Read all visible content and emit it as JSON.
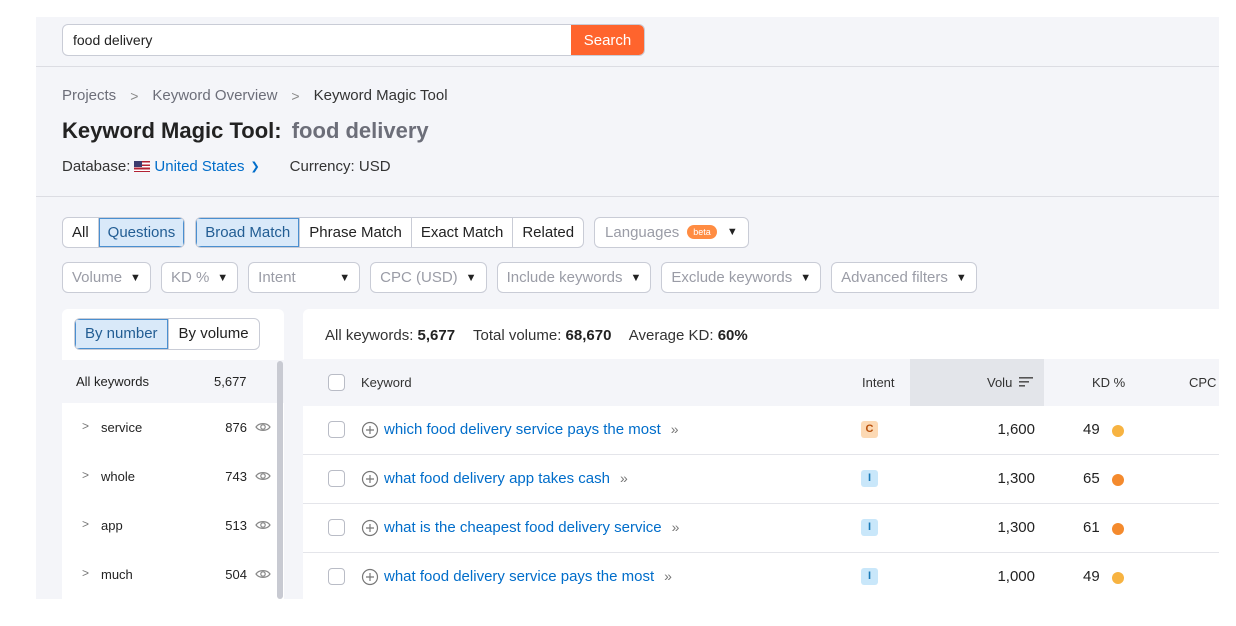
{
  "search": {
    "value": "food delivery",
    "clear_icon": "×",
    "button": "Search"
  },
  "breadcrumb": [
    "Projects",
    "Keyword Overview",
    "Keyword Magic Tool"
  ],
  "breadcrumb_sep": ">",
  "title": {
    "tool": "Keyword Magic Tool:",
    "query": "food delivery"
  },
  "database": {
    "label": "Database:",
    "value": "United States",
    "currency": "Currency: USD"
  },
  "match_tabs": {
    "group1": [
      "All",
      "Questions"
    ],
    "group2": [
      "Broad Match",
      "Phrase Match",
      "Exact Match",
      "Related"
    ]
  },
  "languages": {
    "label": "Languages",
    "badge": "beta"
  },
  "filters": [
    "Volume",
    "KD %",
    "Intent",
    "CPC (USD)",
    "Include keywords",
    "Exclude keywords",
    "Advanced filters"
  ],
  "left_panel": {
    "toggle": [
      "By number",
      "By volume"
    ],
    "all_label": "All keywords",
    "all_count": "5,677",
    "groups": [
      {
        "label": "service",
        "count": "876"
      },
      {
        "label": "whole",
        "count": "743"
      },
      {
        "label": "app",
        "count": "513"
      },
      {
        "label": "much",
        "count": "504"
      }
    ]
  },
  "summary": {
    "all_label": "All keywords:",
    "all_value": "5,677",
    "total_label": "Total volume:",
    "total_value": "68,670",
    "kd_label": "Average KD:",
    "kd_value": "60%"
  },
  "table": {
    "headers": {
      "keyword": "Keyword",
      "intent": "Intent",
      "volume": "Volu",
      "kd": "KD %",
      "cpc": "CPC"
    },
    "rows": [
      {
        "keyword": "which food delivery service pays the most",
        "intent": "C",
        "volume": "1,600",
        "kd": "49",
        "kd_color": "#f7b341"
      },
      {
        "keyword": "what food delivery app takes cash",
        "intent": "I",
        "volume": "1,300",
        "kd": "65",
        "kd_color": "#f48a2d"
      },
      {
        "keyword": "what is the cheapest food delivery service",
        "intent": "I",
        "volume": "1,300",
        "kd": "61",
        "kd_color": "#f48a2d"
      },
      {
        "keyword": "what food delivery service pays the most",
        "intent": "I",
        "volume": "1,000",
        "kd": "49",
        "kd_color": "#f7b341"
      }
    ]
  },
  "colors": {
    "accent": "#ff642d",
    "link": "#006dca",
    "active_bg": "#d9e9f9"
  }
}
